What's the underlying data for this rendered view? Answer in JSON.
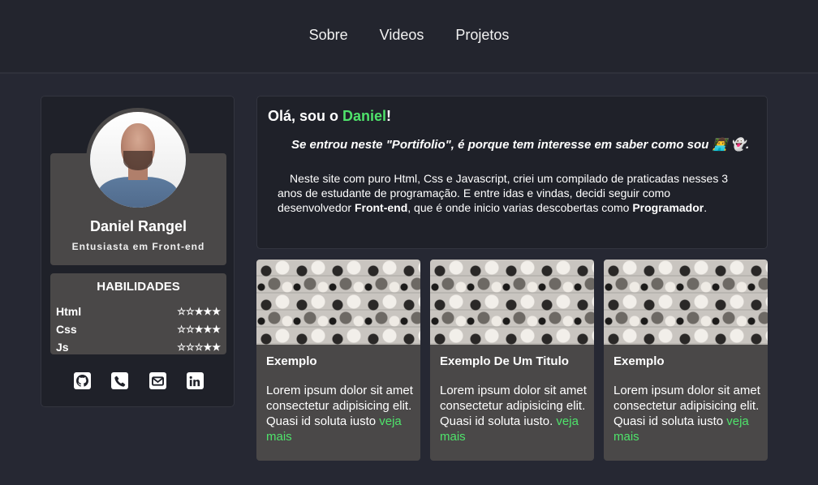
{
  "nav": {
    "items": [
      {
        "label": "Sobre"
      },
      {
        "label": "Videos"
      },
      {
        "label": "Projetos"
      }
    ]
  },
  "profile": {
    "name": "Daniel Rangel",
    "subtitle": "Entusiasta em Front-end",
    "skills_title": "HABILIDADES",
    "skills": [
      {
        "name": "Html",
        "rating": 3,
        "max": 5
      },
      {
        "name": "Css",
        "rating": 3,
        "max": 5
      },
      {
        "name": "Js",
        "rating": 2,
        "max": 5
      }
    ],
    "social": [
      "github-icon",
      "phone-icon",
      "email-icon",
      "linkedin-icon"
    ]
  },
  "intro": {
    "title_prefix": "Olá, sou o ",
    "title_name": "Daniel",
    "title_suffix": "!",
    "quote": "Se entrou neste \"Portifolio\", é porque tem interesse em saber como sou 👨‍💻 👻.",
    "body_1": "Neste site com puro Html, Css e Javascript, criei um compilado de praticadas nesses 3 anos de estudante de programação. E entre idas e vindas, decidi seguir como desenvolvedor ",
    "body_bold_1": "Front-end",
    "body_2": ", que é onde inicio varias descobertas como ",
    "body_bold_2": "Programador",
    "body_3": "."
  },
  "cards": [
    {
      "title": "Exemplo",
      "text": "Lorem ipsum dolor sit amet consectetur adipisicing elit. Quasi id soluta iusto ",
      "link": "veja mais"
    },
    {
      "title": "Exemplo De Um Titulo",
      "text": "Lorem ipsum dolor sit amet consectetur adipisicing elit. Quasi id soluta iusto. ",
      "link": "veja mais"
    },
    {
      "title": "Exemplo",
      "text": "Lorem ipsum dolor sit amet consectetur adipisicing elit. Quasi id soluta iusto ",
      "link": "veja mais"
    }
  ],
  "colors": {
    "accent": "#4fe36b",
    "background": "#262833",
    "panel": "#1f2129",
    "card": "#4a4848"
  }
}
